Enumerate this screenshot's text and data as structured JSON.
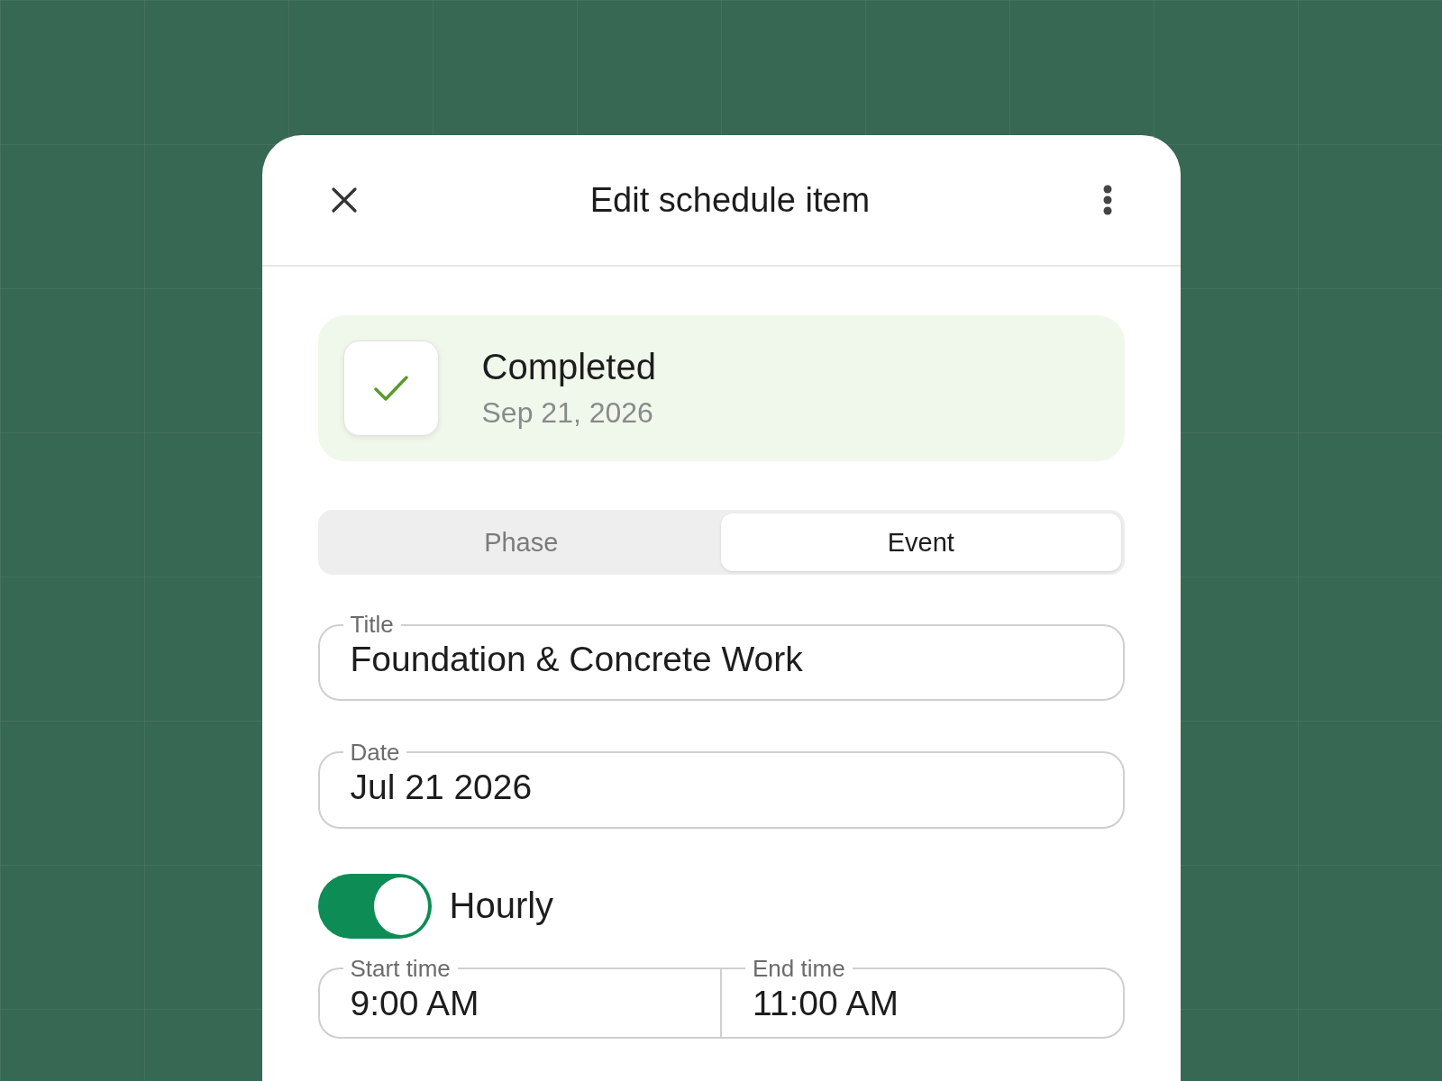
{
  "header": {
    "title": "Edit schedule item"
  },
  "status": {
    "checked": true,
    "label": "Completed",
    "date": "Sep 21, 2026"
  },
  "tabs": [
    {
      "label": "Phase",
      "selected": false
    },
    {
      "label": "Event",
      "selected": true
    }
  ],
  "fields": [
    {
      "label": "Title",
      "value": "Foundation & Concrete Work"
    },
    {
      "label": "Date",
      "value": "Jul 21 2026"
    }
  ],
  "hourly": {
    "label": "Hourly",
    "on": true
  },
  "times": [
    {
      "label": "Start time",
      "value": "9:00 AM"
    },
    {
      "label": "End time",
      "value": "11:00 AM"
    }
  ]
}
